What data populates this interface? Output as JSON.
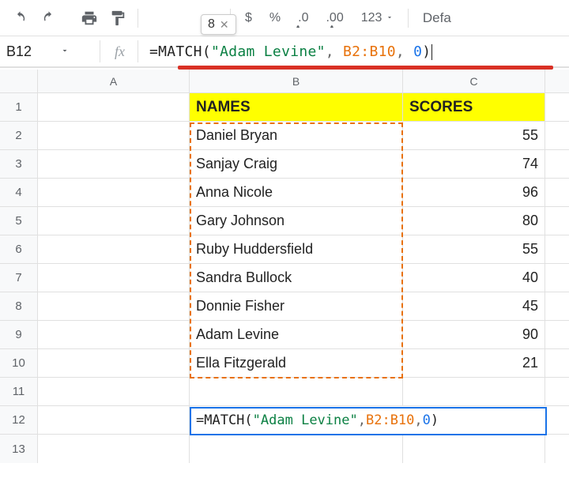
{
  "toolbar": {
    "tooltip_value": "8",
    "currency": "$",
    "percent": "%",
    "dec_dec": ".0",
    "dec_inc": ".00",
    "format_more": "123",
    "font": "Defa"
  },
  "formula_bar": {
    "cell_ref": "B12",
    "fx_label": "fx",
    "prefix": "=MATCH",
    "lparen": "(",
    "str": "\"Adam Levine\"",
    "comma1": ",",
    "range": "B2:B10",
    "comma2": ",",
    "arg3": "0",
    "rparen": ")"
  },
  "columns": {
    "a": "A",
    "b": "B",
    "c": "C"
  },
  "headers": {
    "names": "NAMES",
    "scores": "SCORES"
  },
  "rows": [
    {
      "n": "1"
    },
    {
      "n": "2",
      "name": "Daniel Bryan",
      "score": "55"
    },
    {
      "n": "3",
      "name": "Sanjay Craig",
      "score": "74"
    },
    {
      "n": "4",
      "name": "Anna Nicole",
      "score": "96"
    },
    {
      "n": "5",
      "name": "Gary Johnson",
      "score": "80"
    },
    {
      "n": "6",
      "name": "Ruby Huddersfield",
      "score": "55"
    },
    {
      "n": "7",
      "name": "Sandra Bullock",
      "score": "40"
    },
    {
      "n": "8",
      "name": "Donnie Fisher",
      "score": "45"
    },
    {
      "n": "9",
      "name": "Adam Levine",
      "score": "90"
    },
    {
      "n": "10",
      "name": "Ella Fitzgerald",
      "score": "21"
    },
    {
      "n": "11"
    },
    {
      "n": "12"
    },
    {
      "n": "13"
    }
  ],
  "cell_formula": {
    "prefix": "=MATCH",
    "lparen": "(",
    "str": "\"Adam Levine\"",
    "comma1": ",",
    "range": "B2:B10",
    "comma2": ",",
    "arg3": "0",
    "rparen": ")"
  },
  "chart_data": {
    "type": "table",
    "columns": [
      "NAMES",
      "SCORES"
    ],
    "rows": [
      [
        "Daniel Bryan",
        55
      ],
      [
        "Sanjay Craig",
        74
      ],
      [
        "Anna Nicole",
        96
      ],
      [
        "Gary Johnson",
        80
      ],
      [
        "Ruby Huddersfield",
        55
      ],
      [
        "Sandra Bullock",
        40
      ],
      [
        "Donnie Fisher",
        45
      ],
      [
        "Adam Levine",
        90
      ],
      [
        "Ella Fitzgerald",
        21
      ]
    ],
    "formula": "=MATCH(\"Adam Levine\", B2:B10, 0)",
    "result_preview": 8
  }
}
